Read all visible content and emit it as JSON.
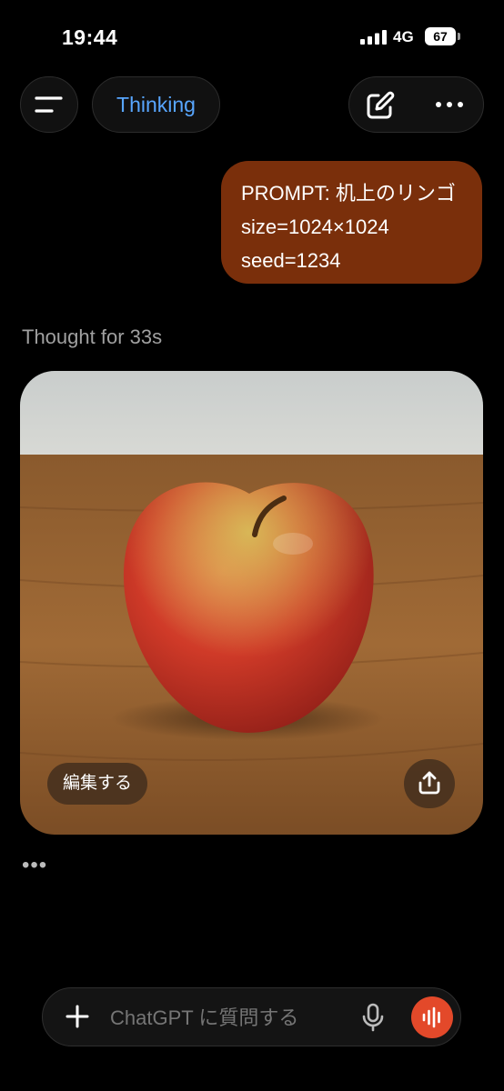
{
  "status_bar": {
    "time": "19:44",
    "network": "4G",
    "battery": "67"
  },
  "header": {
    "mode_label": "Thinking",
    "menu_icon": "menu-icon",
    "edit_icon": "edit-icon",
    "more_icon": "more-icon"
  },
  "user_message": {
    "lines": [
      "PROMPT: 机上のリンゴ",
      "size=1024×1024",
      "seed=1234"
    ]
  },
  "assistant": {
    "thought_label": "Thought for 33s",
    "edit_chip_label": "編集する",
    "share_icon": "share-icon",
    "typing_indicator": "•••"
  },
  "composer": {
    "placeholder": "ChatGPT に質問する",
    "plus_icon": "plus-icon",
    "mic_icon": "mic-icon",
    "voice_icon": "voice-mode-icon"
  },
  "colors": {
    "accent_thinking": "#58a6ff",
    "user_bubble": "#7a2f0b",
    "voice_button": "#e3492a"
  }
}
